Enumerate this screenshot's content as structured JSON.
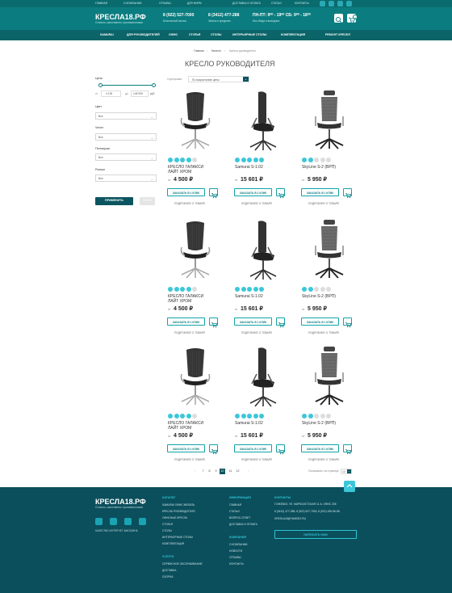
{
  "topbar": {
    "links": [
      "ГЛАВНАЯ",
      "О КОМПАНИИ",
      "ОТЗЫВЫ",
      "ДЛЯ ФИРМ",
      "ДОСТАВКА И ОПЛАТА",
      "СТАТЬИ",
      "КОНТАКТЫ"
    ]
  },
  "header": {
    "logo": "КРЕСЛА18.РФ",
    "slogan": "Стильно, качественно, противоположно",
    "phone1": "8 (922) 527-7000",
    "phone1_note": "Бесплатный звонок",
    "phone2": "8 (3412) 477-288",
    "phone2_note": "Звонок в пределах",
    "hours": "ПН-ПТ: 9⁰⁰ - 19⁰⁰   СБ: 9⁰⁰ - 18⁰⁰",
    "hours_note": "Без обеда и выходных",
    "cart_count": "0"
  },
  "menu": [
    "SAMURAI",
    "ДЛЯ РУКОВОДИТЕЛЕЙ",
    "ОФИС",
    "СТУЛЬЯ",
    "СТОЛЫ",
    "ИНТЕРЬЕРНЫЕ СТОЛЫ",
    "КОМПЛЕКТАЦИЯ",
    "РЕМОНТ КРЕСЕЛ"
  ],
  "breadcrumb": {
    "home": "Главная",
    "sep": "›",
    "catalog": "Каталог",
    "current": "Кресла руководителя"
  },
  "page_title": "КРЕСЛО РУКОВОДИТЕЛЯ",
  "filter": {
    "price_label": "Цена",
    "from_label": "от",
    "from_value": "4 100",
    "to_label": "до",
    "to_value": "145 930",
    "currency": "руб",
    "color_label": "Цвет",
    "color_value": "Все",
    "cover_label": "Чехол",
    "cover_value": "Все",
    "stitch_label": "Петлицкая",
    "stitch_value": "Все",
    "wheels_label": "Ролики",
    "wheels_value": "Все",
    "apply": "ПРИМЕНИТЬ",
    "reset": "СБРОС"
  },
  "sort": {
    "label": "Сортировка",
    "value": "По возрастанию цены"
  },
  "products": [
    {
      "title": "КРЕСЛО ГАЛАКСИ ЛАЙТ ХРОМ",
      "from": "от",
      "price": "4 500 ₽",
      "rating": 4
    },
    {
      "title": "Samurai S-1.02",
      "from": "от",
      "price": "15 601 ₽",
      "rating": 5
    },
    {
      "title": "SkyLine S-2 (ВРП)",
      "from": "от",
      "price": "5 950 ₽",
      "rating": 2
    },
    {
      "title": "КРЕСЛО ГАЛАКСИ ЛАЙТ ХРОМ",
      "from": "от",
      "price": "4 500 ₽",
      "rating": 4
    },
    {
      "title": "Samurai S-1.02",
      "from": "от",
      "price": "15 601 ₽",
      "rating": 5
    },
    {
      "title": "SkyLine S-2 (ВРП)",
      "from": "от",
      "price": "5 950 ₽",
      "rating": 2
    },
    {
      "title": "КРЕСЛО ГАЛАКСИ ЛАЙТ ХРОМ",
      "from": "от",
      "price": "4 500 ₽",
      "rating": 4
    },
    {
      "title": "Samurai S-1.02",
      "from": "от",
      "price": "15 601 ₽",
      "rating": 5
    },
    {
      "title": "SkyLine S-2 (ВРП)",
      "from": "от",
      "price": "5 950 ₽",
      "rating": 2
    }
  ],
  "labels": {
    "order": "ЗАКАЗАТЬ В 1 КЛИК",
    "more": "ПОДРОБНЕЕ О ТОВАРЕ"
  },
  "pagination": {
    "prev": "‹",
    "pages": [
      "7",
      "8",
      "9",
      "10",
      "11",
      "12"
    ],
    "active": "10",
    "next": "›",
    "per_page_label": "Показывать на странице",
    "per_page": "12"
  },
  "footer": {
    "logo": "КРЕСЛА18.РФ",
    "slogan": "Стильно, качественно, противоположно",
    "copyright": "КАЧЕСТВО ИНТЕРНЕТ-МАГАЗИНА",
    "catalog_title": "КАТАЛОГ",
    "catalog_links": [
      "SAMURAI ОФИС МЕБЕЛЬ",
      "КРЕСЛА РУКОВОДИТЕЛЯ",
      "ОФИСНЫЕ КРЕСЛА",
      "СТУЛЬЯ",
      "СТОЛЫ",
      "ИНТЕРЬЕРНЫЕ СТОЛЫ",
      "КОМПЛЕКТАЦИЯ"
    ],
    "services_title": "УСЛУГИ",
    "services_links": [
      "СЕРВИСНОЕ ОБСЛУЖИВАНИЕ",
      "ДОСТАВКА",
      "СБОРКА"
    ],
    "info_title": "ИНФОРМАЦИЯ",
    "info_links": [
      "ГЛАВНАЯ",
      "СТАТЬИ",
      "ВОПРОС-ОТВЕТ",
      "ДОСТАВКА И ОПЛАТА"
    ],
    "company_title": "КОМПАНИЯ",
    "company_links": [
      "О КОМПАНИИ",
      "НОВОСТИ",
      "ОТЗЫВЫ",
      "КОНТАКТЫ"
    ],
    "contacts_title": "КОНТАКТЫ",
    "address": "Г.ИЖЕВСК, УЛ. МАРКСИСТСКАЯ 11 А, ОФИС 206",
    "phones": "8 (3412) 477-288, 8 (922) 527-7000, 8 (922) 490-56-88",
    "email": "KRESLA18@YANDEX.RU",
    "write_button": "НАПИСАТЬ НАМ",
    "social": [
      "vk-icon",
      "facebook-icon",
      "ok-icon",
      "instagram-icon"
    ]
  },
  "colors": {
    "teal": "#0b7d80",
    "dark_teal": "#0a6468",
    "footer": "#0b4f5c",
    "star": "#3cc7d8",
    "accent": "#12a3a9"
  }
}
